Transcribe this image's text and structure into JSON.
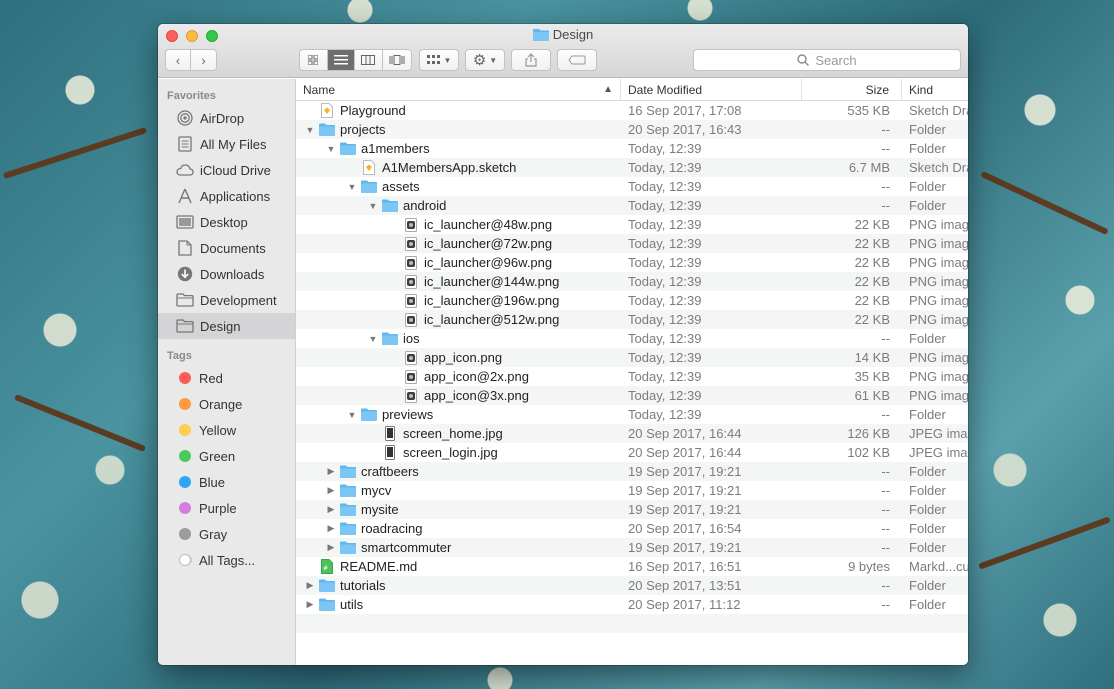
{
  "window": {
    "title": "Design",
    "search_placeholder": "Search"
  },
  "sidebar": {
    "favorites_header": "Favorites",
    "favorites": [
      {
        "label": "AirDrop",
        "icon": "airdrop-icon"
      },
      {
        "label": "All My Files",
        "icon": "all-my-files-icon"
      },
      {
        "label": "iCloud Drive",
        "icon": "cloud-icon"
      },
      {
        "label": "Applications",
        "icon": "applications-icon"
      },
      {
        "label": "Desktop",
        "icon": "desktop-icon"
      },
      {
        "label": "Documents",
        "icon": "documents-icon"
      },
      {
        "label": "Downloads",
        "icon": "downloads-icon"
      },
      {
        "label": "Development",
        "icon": "folder-icon"
      },
      {
        "label": "Design",
        "icon": "folder-icon",
        "selected": true
      }
    ],
    "tags_header": "Tags",
    "tags": [
      {
        "label": "Red",
        "color": "#fc5c57"
      },
      {
        "label": "Orange",
        "color": "#fd9a3e"
      },
      {
        "label": "Yellow",
        "color": "#fdcf4e"
      },
      {
        "label": "Green",
        "color": "#4cc95c"
      },
      {
        "label": "Blue",
        "color": "#2ea6f7"
      },
      {
        "label": "Purple",
        "color": "#d47fe0"
      },
      {
        "label": "Gray",
        "color": "#9c9c9c"
      },
      {
        "label": "All Tags...",
        "color": "#d8d8d8"
      }
    ]
  },
  "columns": {
    "name": "Name",
    "date": "Date Modified",
    "size": "Size",
    "kind": "Kind"
  },
  "files": [
    {
      "name": "Playground",
      "date": "16 Sep 2017, 17:08",
      "size": "535 KB",
      "kind": "Sketch Drawing",
      "type": "sketch",
      "depth": 0,
      "disclosure": "none"
    },
    {
      "name": "projects",
      "date": "20 Sep 2017, 16:43",
      "size": "--",
      "kind": "Folder",
      "type": "folder",
      "depth": 0,
      "disclosure": "open"
    },
    {
      "name": "a1members",
      "date": "Today, 12:39",
      "size": "--",
      "kind": "Folder",
      "type": "folder",
      "depth": 1,
      "disclosure": "open"
    },
    {
      "name": "A1MembersApp.sketch",
      "date": "Today, 12:39",
      "size": "6.7 MB",
      "kind": "Sketch Drawing",
      "type": "sketch",
      "depth": 2,
      "disclosure": "none"
    },
    {
      "name": "assets",
      "date": "Today, 12:39",
      "size": "--",
      "kind": "Folder",
      "type": "folder",
      "depth": 2,
      "disclosure": "open"
    },
    {
      "name": "android",
      "date": "Today, 12:39",
      "size": "--",
      "kind": "Folder",
      "type": "folder",
      "depth": 3,
      "disclosure": "open"
    },
    {
      "name": "ic_launcher@48w.png",
      "date": "Today, 12:39",
      "size": "22 KB",
      "kind": "PNG image",
      "type": "png",
      "depth": 4,
      "disclosure": "none"
    },
    {
      "name": "ic_launcher@72w.png",
      "date": "Today, 12:39",
      "size": "22 KB",
      "kind": "PNG image",
      "type": "png",
      "depth": 4,
      "disclosure": "none"
    },
    {
      "name": "ic_launcher@96w.png",
      "date": "Today, 12:39",
      "size": "22 KB",
      "kind": "PNG image",
      "type": "png",
      "depth": 4,
      "disclosure": "none"
    },
    {
      "name": "ic_launcher@144w.png",
      "date": "Today, 12:39",
      "size": "22 KB",
      "kind": "PNG image",
      "type": "png",
      "depth": 4,
      "disclosure": "none"
    },
    {
      "name": "ic_launcher@196w.png",
      "date": "Today, 12:39",
      "size": "22 KB",
      "kind": "PNG image",
      "type": "png",
      "depth": 4,
      "disclosure": "none"
    },
    {
      "name": "ic_launcher@512w.png",
      "date": "Today, 12:39",
      "size": "22 KB",
      "kind": "PNG image",
      "type": "png",
      "depth": 4,
      "disclosure": "none"
    },
    {
      "name": "ios",
      "date": "Today, 12:39",
      "size": "--",
      "kind": "Folder",
      "type": "folder",
      "depth": 3,
      "disclosure": "open"
    },
    {
      "name": "app_icon.png",
      "date": "Today, 12:39",
      "size": "14 KB",
      "kind": "PNG image",
      "type": "png",
      "depth": 4,
      "disclosure": "none"
    },
    {
      "name": "app_icon@2x.png",
      "date": "Today, 12:39",
      "size": "35 KB",
      "kind": "PNG image",
      "type": "png",
      "depth": 4,
      "disclosure": "none"
    },
    {
      "name": "app_icon@3x.png",
      "date": "Today, 12:39",
      "size": "61 KB",
      "kind": "PNG image",
      "type": "png",
      "depth": 4,
      "disclosure": "none"
    },
    {
      "name": "previews",
      "date": "Today, 12:39",
      "size": "--",
      "kind": "Folder",
      "type": "folder",
      "depth": 2,
      "disclosure": "open"
    },
    {
      "name": "screen_home.jpg",
      "date": "20 Sep 2017, 16:44",
      "size": "126 KB",
      "kind": "JPEG image",
      "type": "jpg",
      "depth": 3,
      "disclosure": "none"
    },
    {
      "name": "screen_login.jpg",
      "date": "20 Sep 2017, 16:44",
      "size": "102 KB",
      "kind": "JPEG image",
      "type": "jpg",
      "depth": 3,
      "disclosure": "none"
    },
    {
      "name": "craftbeers",
      "date": "19 Sep 2017, 19:21",
      "size": "--",
      "kind": "Folder",
      "type": "folder",
      "depth": 1,
      "disclosure": "closed"
    },
    {
      "name": "mycv",
      "date": "19 Sep 2017, 19:21",
      "size": "--",
      "kind": "Folder",
      "type": "folder",
      "depth": 1,
      "disclosure": "closed"
    },
    {
      "name": "mysite",
      "date": "19 Sep 2017, 19:21",
      "size": "--",
      "kind": "Folder",
      "type": "folder",
      "depth": 1,
      "disclosure": "closed"
    },
    {
      "name": "roadracing",
      "date": "20 Sep 2017, 16:54",
      "size": "--",
      "kind": "Folder",
      "type": "folder",
      "depth": 1,
      "disclosure": "closed"
    },
    {
      "name": "smartcommuter",
      "date": "19 Sep 2017, 19:21",
      "size": "--",
      "kind": "Folder",
      "type": "folder",
      "depth": 1,
      "disclosure": "closed"
    },
    {
      "name": "README.md",
      "date": "16 Sep 2017, 16:51",
      "size": "9 bytes",
      "kind": "Markd...cument",
      "type": "md",
      "depth": 0,
      "disclosure": "none"
    },
    {
      "name": "tutorials",
      "date": "20 Sep 2017, 13:51",
      "size": "--",
      "kind": "Folder",
      "type": "folder",
      "depth": 0,
      "disclosure": "closed"
    },
    {
      "name": "utils",
      "date": "20 Sep 2017, 11:12",
      "size": "--",
      "kind": "Folder",
      "type": "folder",
      "depth": 0,
      "disclosure": "closed"
    }
  ],
  "colors": {
    "folder": "#5fb6f1",
    "selection": "#d4d4d6"
  }
}
